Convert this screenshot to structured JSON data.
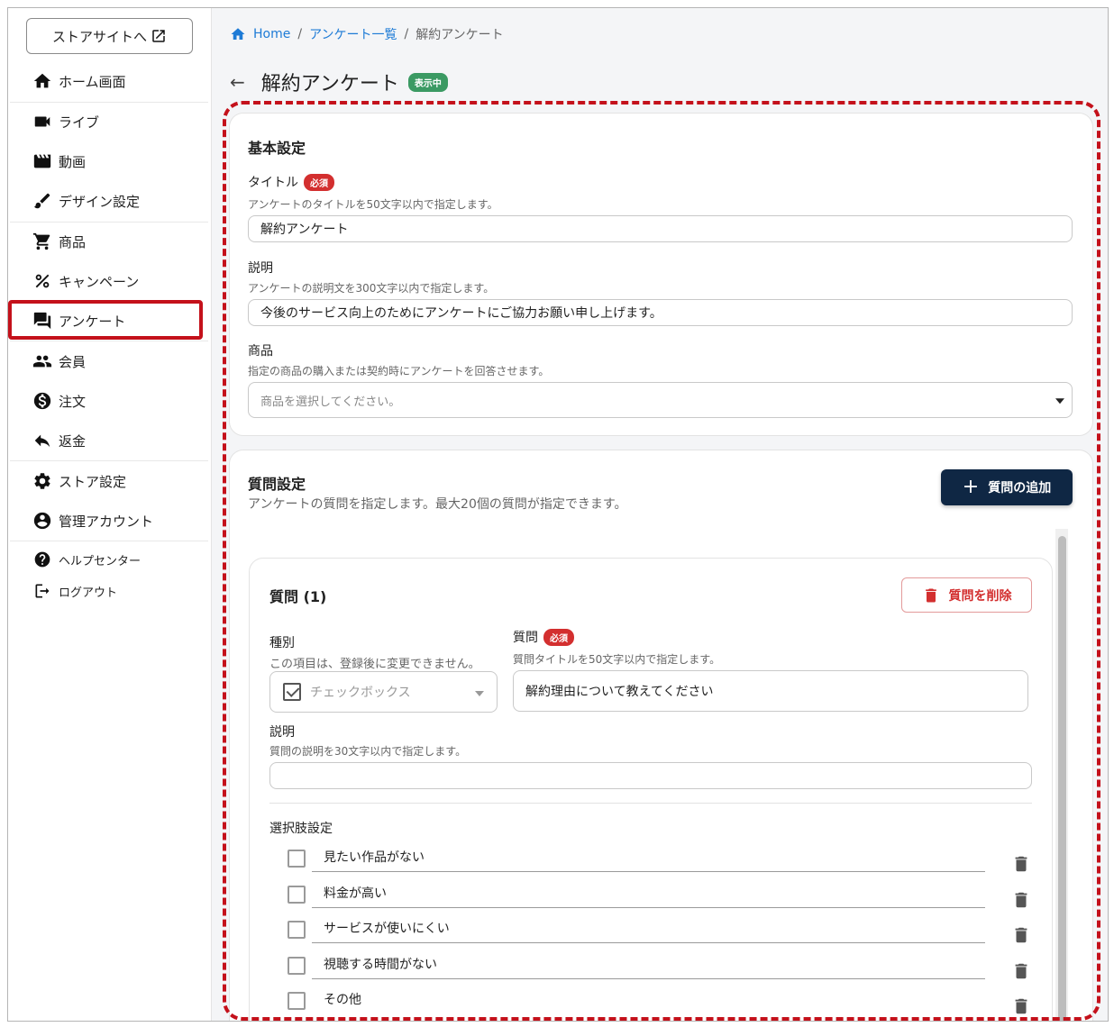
{
  "sidebar": {
    "store_button": "ストアサイトへ",
    "items": [
      {
        "label": "ホーム画面",
        "icon": "home-icon"
      },
      {
        "label": "ライブ",
        "icon": "videocam-icon"
      },
      {
        "label": "動画",
        "icon": "movie-icon"
      },
      {
        "label": "デザイン設定",
        "icon": "brush-icon"
      },
      {
        "label": "商品",
        "icon": "cart-icon"
      },
      {
        "label": "キャンペーン",
        "icon": "percent-icon"
      },
      {
        "label": "アンケート",
        "icon": "forum-icon"
      },
      {
        "label": "会員",
        "icon": "people-icon"
      },
      {
        "label": "注文",
        "icon": "dollar-icon"
      },
      {
        "label": "返金",
        "icon": "reply-icon"
      },
      {
        "label": "ストア設定",
        "icon": "gear-icon"
      },
      {
        "label": "管理アカウント",
        "icon": "account-icon"
      },
      {
        "label": "ヘルプセンター",
        "icon": "help-icon"
      },
      {
        "label": "ログアウト",
        "icon": "logout-icon"
      }
    ]
  },
  "breadcrumb": {
    "home": "Home",
    "sep": "/",
    "list": "アンケート一覧",
    "current": "解約アンケート"
  },
  "header": {
    "title": "解約アンケート",
    "status_badge": "表示中"
  },
  "basic": {
    "section_title": "基本設定",
    "title_label": "タイトル",
    "required": "必須",
    "title_hint": "アンケートのタイトルを50文字以内で指定します。",
    "title_value": "解約アンケート",
    "desc_label": "説明",
    "desc_hint": "アンケートの説明文を300文字以内で指定します。",
    "desc_value": "今後のサービス向上のためにアンケートにご協力お願い申し上げます。",
    "product_label": "商品",
    "product_hint": "指定の商品の購入または契約時にアンケートを回答させます。",
    "product_placeholder": "商品を選択してください。"
  },
  "questions": {
    "section_title": "質問設定",
    "hint": "アンケートの質問を指定します。最大20個の質問が指定できます。",
    "add_button": "質問の追加",
    "q1": {
      "title": "質問 (1)",
      "delete_button": "質問を削除",
      "type_label": "種別",
      "type_hint": "この項目は、登録後に変更できません。",
      "type_value": "チェックボックス",
      "question_label": "質問",
      "required": "必須",
      "question_hint": "質問タイトルを50文字以内で指定します。",
      "question_value": "解約理由について教えてください",
      "desc_label": "説明",
      "desc_hint": "質問の説明を30文字以内で指定します。",
      "desc_value": "",
      "options_label": "選択肢設定",
      "options": [
        "見たい作品がない",
        "料金が高い",
        "サービスが使いにくい",
        "視聴する時間がない",
        "その他"
      ]
    }
  }
}
